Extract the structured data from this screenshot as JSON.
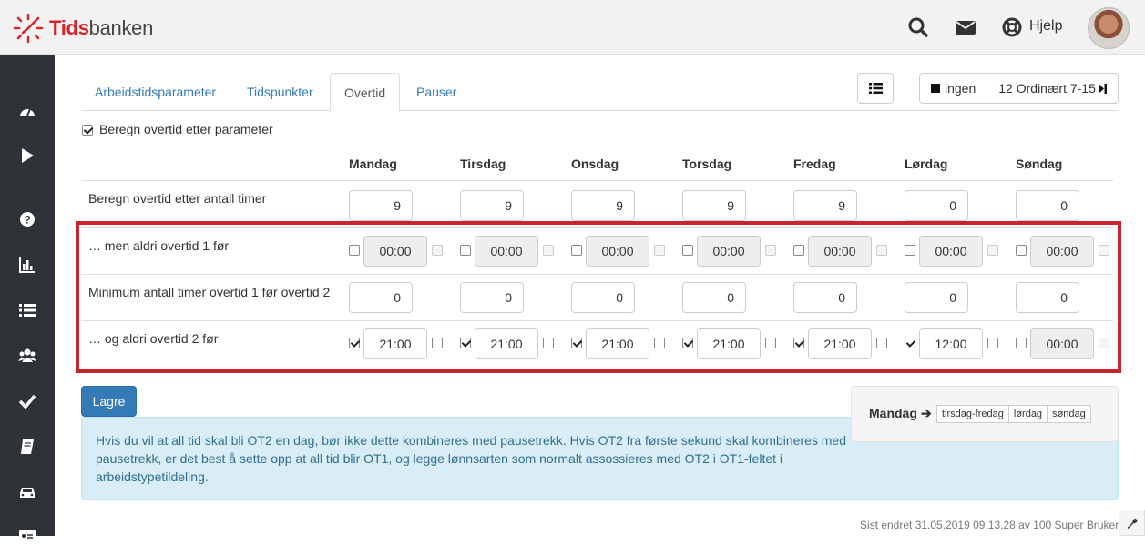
{
  "app": {
    "logo_prefix": "Tids",
    "logo_suffix": "banken",
    "help_label": "Hjelp"
  },
  "tabs": [
    {
      "label": "Arbeidstidsparameter",
      "active": false
    },
    {
      "label": "Tidspunkter",
      "active": false
    },
    {
      "label": "Overtid",
      "active": true
    },
    {
      "label": "Pauser",
      "active": false
    }
  ],
  "toolbar": {
    "ingen_label": "ingen",
    "schedule_label": "12 Ordinært 7-15"
  },
  "calc_param": {
    "label": "Beregn overtid etter parameter",
    "checked": true
  },
  "days": [
    "Mandag",
    "Tirsdag",
    "Onsdag",
    "Torsdag",
    "Fredag",
    "Lørdag",
    "Søndag"
  ],
  "rows": {
    "hours": {
      "label": "Beregn overtid etter antall timer",
      "values": [
        "9",
        "9",
        "9",
        "9",
        "9",
        "0",
        "0"
      ]
    },
    "never_ot1_before": {
      "label": "… men aldri overtid 1 før",
      "values": [
        "00:00",
        "00:00",
        "00:00",
        "00:00",
        "00:00",
        "00:00",
        "00:00"
      ],
      "checked": [
        false,
        false,
        false,
        false,
        false,
        false,
        false
      ]
    },
    "min_hours": {
      "label": "Minimum antall timer overtid 1 før overtid 2",
      "values": [
        "0",
        "0",
        "0",
        "0",
        "0",
        "0",
        "0"
      ]
    },
    "never_ot2_before": {
      "label": "… og aldri overtid 2 før",
      "values": [
        "21:00",
        "21:00",
        "21:00",
        "21:00",
        "21:00",
        "12:00",
        "00:00"
      ],
      "checked": [
        true,
        true,
        true,
        true,
        true,
        true,
        false
      ]
    }
  },
  "save_label": "Lagre",
  "copy": {
    "from_label": "Mandag",
    "targets": [
      "tirsdag-fredag",
      "lørdag",
      "søndag"
    ]
  },
  "info_text": "Hvis du vil at all tid skal bli OT2 en dag, bør ikke dette kombineres med pausetrekk. Hvis OT2 fra første sekund skal kombineres med pausetrekk, er det best å sette opp at all tid blir OT1, og legge lønnsarten som normalt assossieres med OT2 i OT1-feltet i arbeidstypetildeling.",
  "footer": "Sist endret 31.05.2019 09.13.28 av 100 Super Bruker",
  "colors": {
    "accent": "#337ab7",
    "brand_red": "#d7242a",
    "highlight": "#c8242e",
    "sidebar": "#2f3237"
  }
}
